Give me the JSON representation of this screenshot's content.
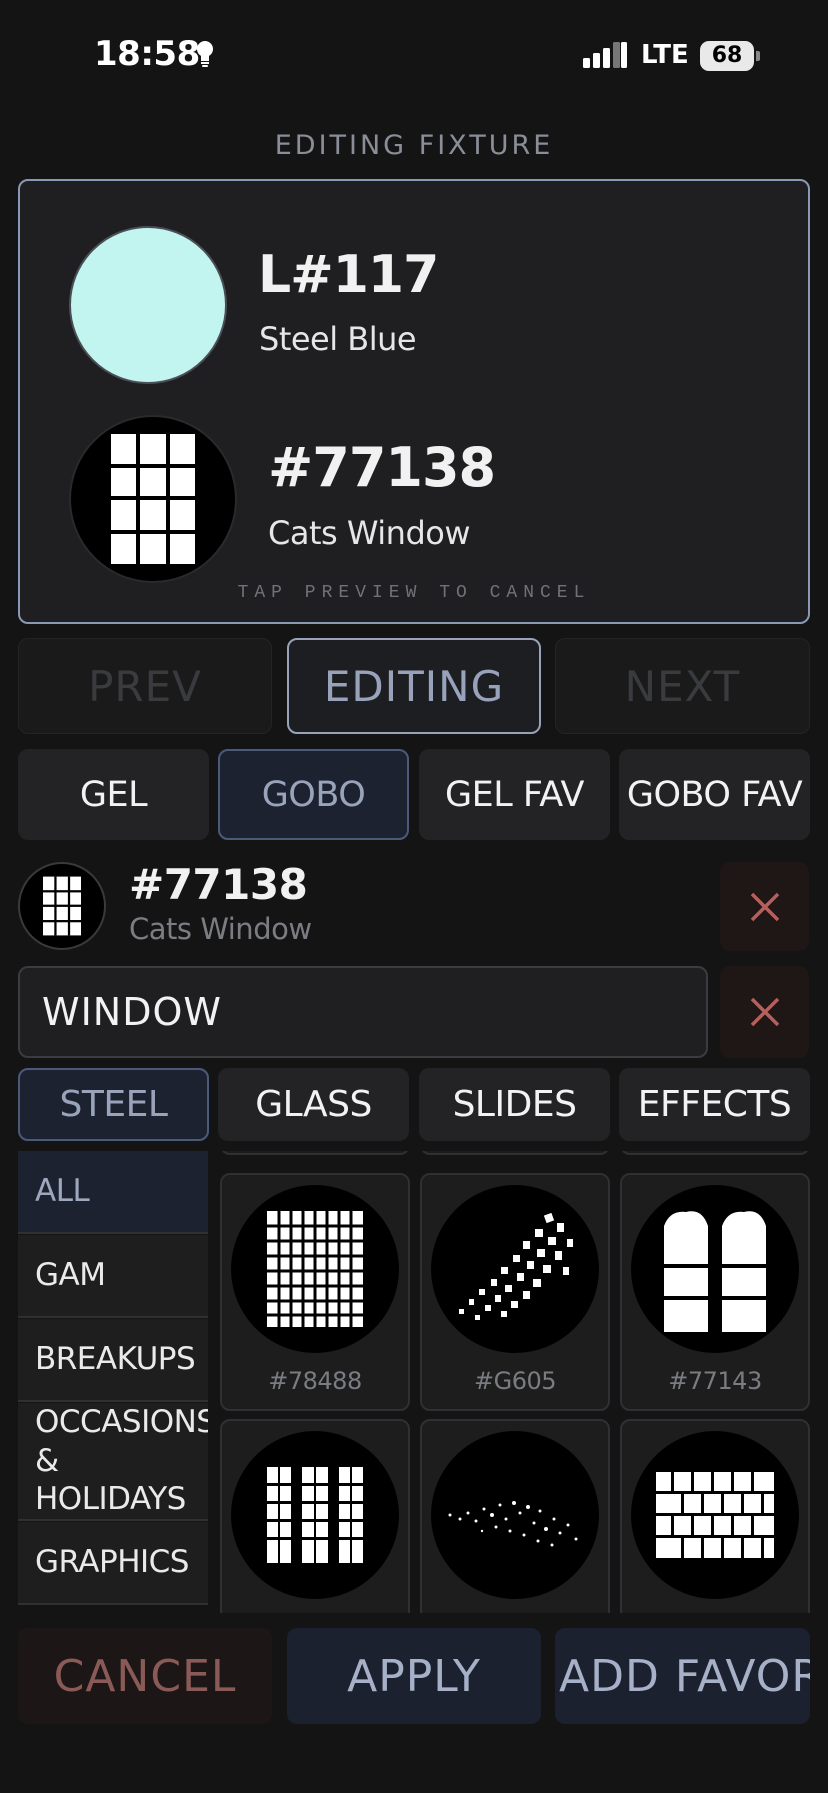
{
  "status": {
    "time": "18:58",
    "network": "LTE",
    "battery": "68"
  },
  "heading": "EDITING FIXTURE",
  "preview": {
    "color_code": "L#117",
    "color_name": "Steel Blue",
    "color_hex": "#c2f4f0",
    "gobo_code": "#77138",
    "gobo_name": "Cats Window",
    "hint": "TAP PREVIEW TO CANCEL"
  },
  "nav": {
    "prev": "PREV",
    "editing": "EDITING",
    "next": "NEXT"
  },
  "modes": [
    "GEL",
    "GOBO",
    "GEL FAV",
    "GOBO FAV"
  ],
  "selected": {
    "code": "#77138",
    "name": "Cats Window"
  },
  "search": {
    "value": "WINDOW"
  },
  "categories": [
    "STEEL",
    "GLASS",
    "SLIDES",
    "EFFECTS"
  ],
  "sidebar": [
    "ALL",
    "GAM",
    "BREAKUPS",
    "OCCASIONS & HOLIDAYS",
    "GRAPHICS"
  ],
  "gobos": [
    {
      "code": "#78488",
      "icon": "window-grid-icon"
    },
    {
      "code": "#G605",
      "icon": "scattered-windows-icon"
    },
    {
      "code": "#77143",
      "icon": "arched-window-icon"
    },
    {
      "code": "",
      "icon": "triple-window-icon"
    },
    {
      "code": "",
      "icon": "city-lights-icon"
    },
    {
      "code": "",
      "icon": "brick-window-icon"
    }
  ],
  "footer": {
    "cancel": "CANCEL",
    "apply": "APPLY",
    "favorite": "ADD FAVORIT"
  },
  "colors": {
    "accent": "#98a3bb",
    "danger": "#c26a66",
    "background": "#141415"
  }
}
